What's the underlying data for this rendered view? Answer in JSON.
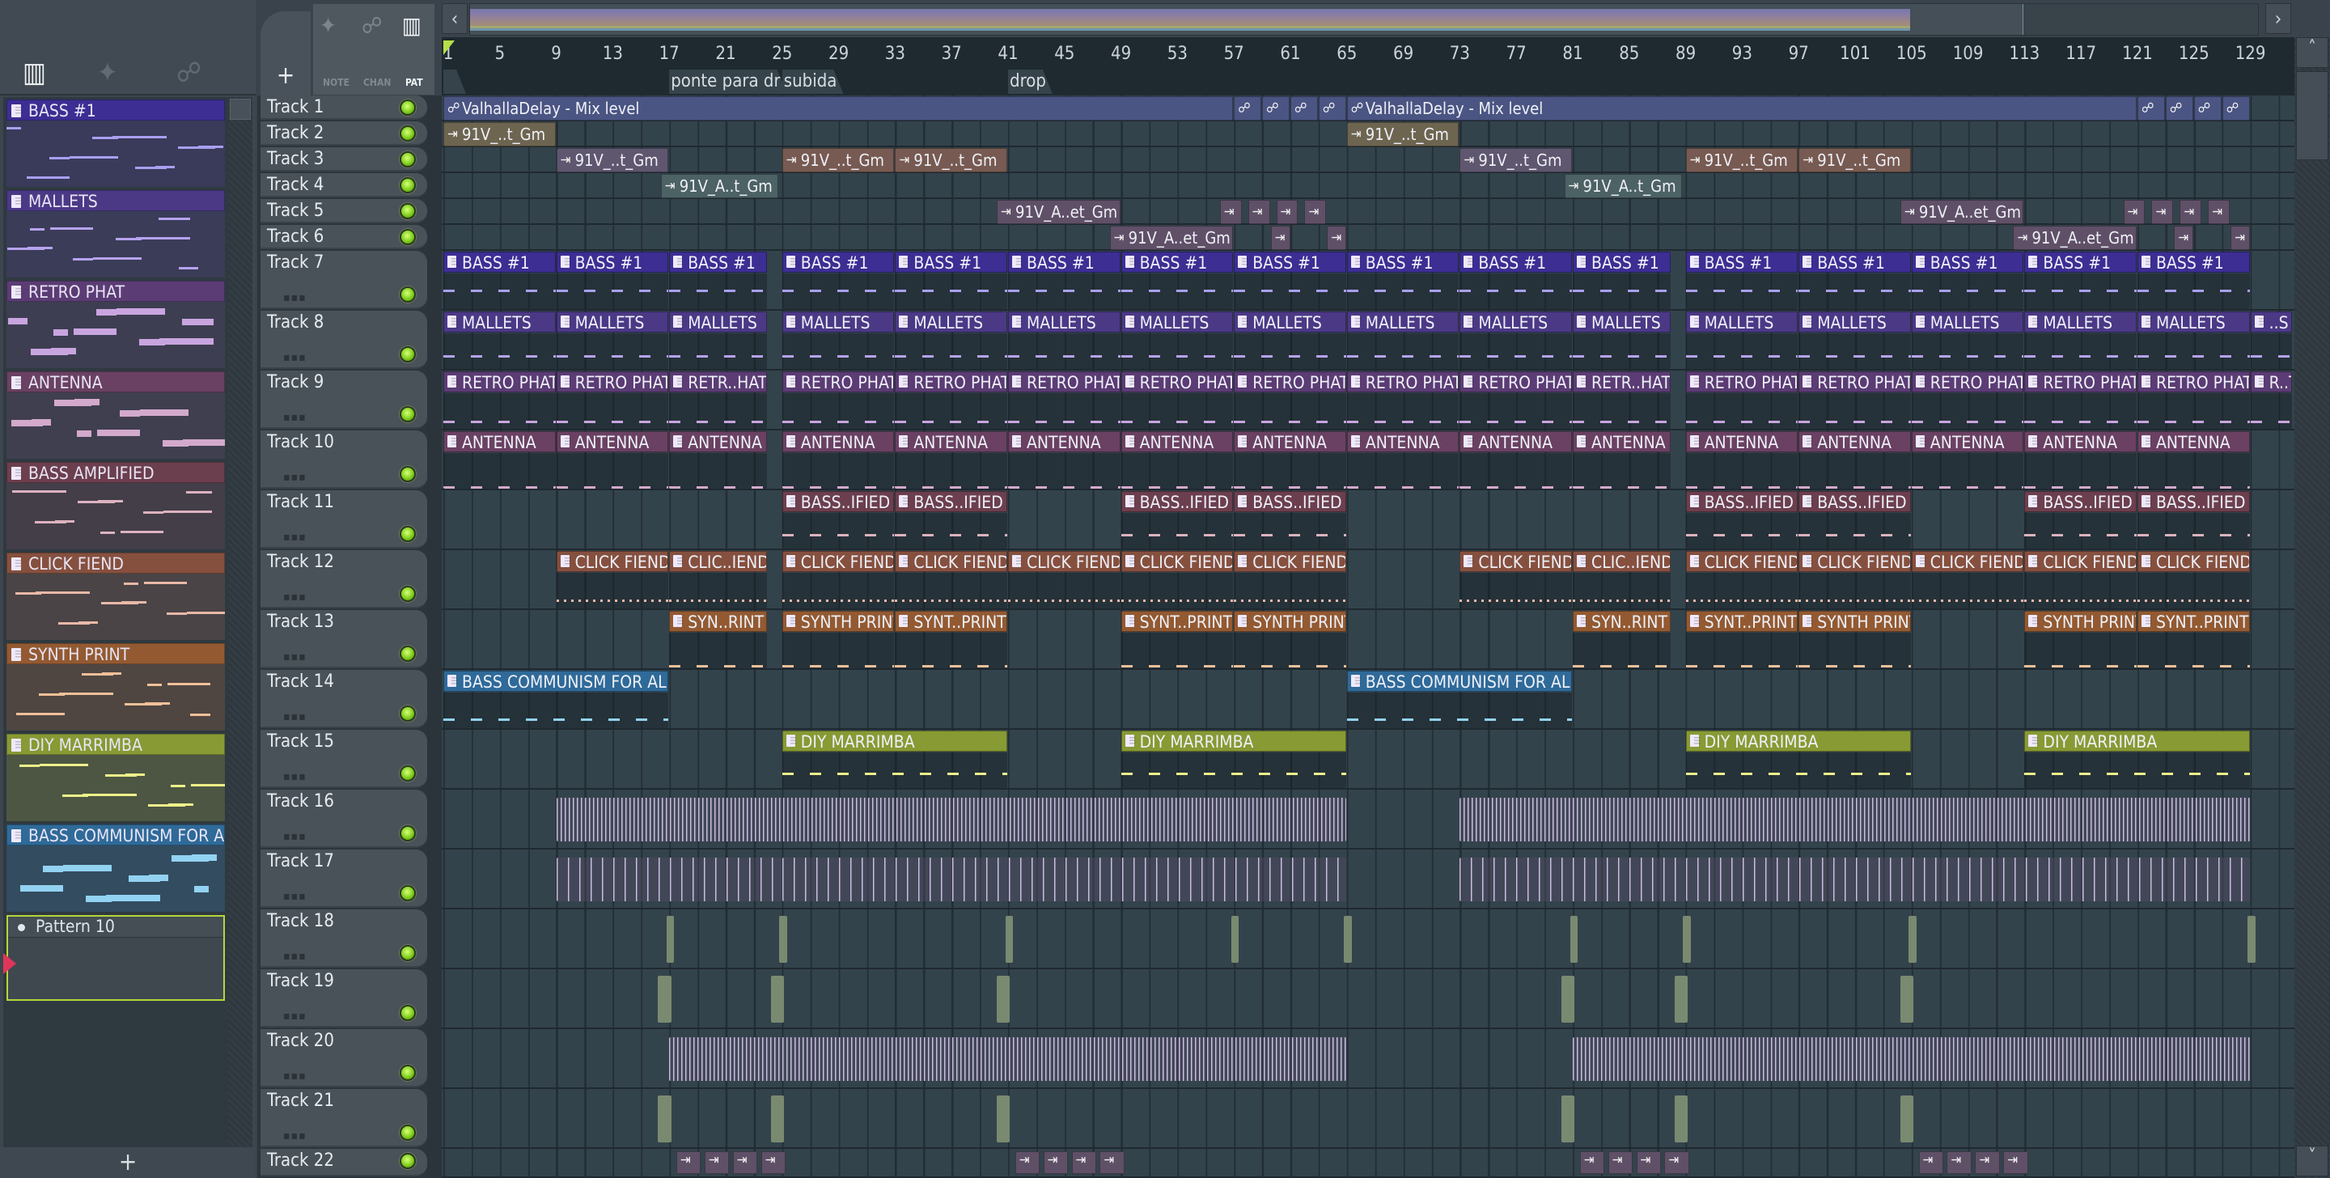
{
  "toolbar": {
    "note": "NOTE",
    "chan": "CHAN",
    "pat": "PAT",
    "add": "+",
    "add_pattern": "+",
    "nav_left": "‹",
    "nav_right": "›",
    "scroll_up": "˄",
    "scroll_down": "˅"
  },
  "ruler": {
    "bars": [
      "1",
      "5",
      "9",
      "13",
      "17",
      "21",
      "25",
      "29",
      "33",
      "37",
      "41",
      "45",
      "49",
      "53",
      "57",
      "61",
      "65",
      "69",
      "73",
      "77",
      "81",
      "85",
      "89",
      "93",
      "97",
      "101",
      "105",
      "109",
      "113",
      "117",
      "121",
      "125",
      "129"
    ]
  },
  "markers": [
    {
      "bar": 1,
      "label": ""
    },
    {
      "bar": 17,
      "label": "ponte para dr"
    },
    {
      "bar": 25,
      "label": "subida"
    },
    {
      "bar": 41,
      "label": "drop"
    }
  ],
  "patterns": [
    {
      "name": "BASS #1",
      "color": "#3c2e93",
      "body": "#3a3a5a",
      "note": "#a99ff0"
    },
    {
      "name": "MALLETS",
      "color": "#4b3986",
      "body": "#3b3c58",
      "note": "#b6a3ef"
    },
    {
      "name": "RETRO PHAT",
      "color": "#5b3c74",
      "body": "#3e3e52",
      "note": "#c9a5e0"
    },
    {
      "name": "ANTENNA",
      "color": "#6a4162",
      "body": "#403f4f",
      "note": "#d3a9cc"
    },
    {
      "name": "BASS AMPLIFIED",
      "color": "#6c3f4e",
      "body": "#433e48",
      "note": "#ddb2bf"
    },
    {
      "name": "CLICK FIEND",
      "color": "#86503f",
      "body": "#4a4446",
      "note": "#e9b8a8"
    },
    {
      "name": "SYNTH PRINT",
      "color": "#935a32",
      "body": "#4f4642",
      "note": "#f0c098"
    },
    {
      "name": "DIY MARRIMBA",
      "color": "#879a34",
      "body": "#4d5642",
      "note": "#eef08a"
    },
    {
      "name": "BASS COMMUNISM FOR ALL",
      "color": "#2f6a99",
      "body": "#334c60",
      "note": "#92d2f2"
    }
  ],
  "selected_pattern": "Pattern 10",
  "tracks": [
    "Track 1",
    "Track 2",
    "Track 3",
    "Track 4",
    "Track 5",
    "Track 6",
    "Track 7",
    "Track 8",
    "Track 9",
    "Track 10",
    "Track 11",
    "Track 12",
    "Track 13",
    "Track 14",
    "Track 15",
    "Track 16",
    "Track 17",
    "Track 18",
    "Track 19",
    "Track 20",
    "Track 21",
    "Track 22"
  ],
  "colors": {
    "auto": "#4b5583",
    "tan": "#6d6550",
    "mauve": "#5f566f",
    "brown": "#775a52",
    "teal": "#4c6264",
    "plum": "#5f5068",
    "wave": "#c9bde0"
  },
  "clips": [
    {
      "t": 1,
      "s": 1,
      "l": 56,
      "k": "auto",
      "c": "auto",
      "label": "ValhallaDelay - Mix level"
    },
    {
      "t": 1,
      "s": 57,
      "l": 2,
      "k": "auto",
      "c": "auto",
      "label": ""
    },
    {
      "t": 1,
      "s": 59,
      "l": 2,
      "k": "auto",
      "c": "auto",
      "label": ""
    },
    {
      "t": 1,
      "s": 61,
      "l": 2,
      "k": "auto",
      "c": "auto",
      "label": ""
    },
    {
      "t": 1,
      "s": 63,
      "l": 2,
      "k": "auto",
      "c": "auto",
      "label": ""
    },
    {
      "t": 1,
      "s": 65,
      "l": 56,
      "k": "auto",
      "c": "auto",
      "label": "ValhallaDelay - Mix level"
    },
    {
      "t": 1,
      "s": 121,
      "l": 2,
      "k": "auto",
      "c": "auto",
      "label": ""
    },
    {
      "t": 1,
      "s": 123,
      "l": 2,
      "k": "auto",
      "c": "auto",
      "label": ""
    },
    {
      "t": 1,
      "s": 125,
      "l": 2,
      "k": "auto",
      "c": "auto",
      "label": ""
    },
    {
      "t": 1,
      "s": 127,
      "l": 2,
      "k": "auto",
      "c": "auto",
      "label": ""
    },
    {
      "t": 2,
      "s": 1,
      "l": 8,
      "k": "audio",
      "c": "tan",
      "label": "91V_..t_Gm"
    },
    {
      "t": 2,
      "s": 65,
      "l": 8,
      "k": "audio",
      "c": "tan",
      "label": "91V_..t_Gm"
    },
    {
      "t": 3,
      "s": 9,
      "l": 8,
      "k": "audio",
      "c": "mauve",
      "label": "91V_..t_Gm"
    },
    {
      "t": 3,
      "s": 25,
      "l": 8,
      "k": "audio",
      "c": "brown",
      "label": "91V_..t_Gm"
    },
    {
      "t": 3,
      "s": 33,
      "l": 8,
      "k": "audio",
      "c": "brown",
      "label": "91V_..t_Gm"
    },
    {
      "t": 3,
      "s": 73,
      "l": 8,
      "k": "audio",
      "c": "mauve",
      "label": "91V_..t_Gm"
    },
    {
      "t": 3,
      "s": 89,
      "l": 8,
      "k": "audio",
      "c": "brown",
      "label": "91V_..t_Gm"
    },
    {
      "t": 3,
      "s": 97,
      "l": 8,
      "k": "audio",
      "c": "brown",
      "label": "91V_..t_Gm"
    },
    {
      "t": 4,
      "s": 16.4,
      "l": 8.4,
      "k": "audio",
      "c": "teal",
      "label": "91V_A..t_Gm"
    },
    {
      "t": 4,
      "s": 80.4,
      "l": 8.4,
      "k": "audio",
      "c": "teal",
      "label": "91V_A..t_Gm"
    },
    {
      "t": 5,
      "s": 40.2,
      "l": 8.8,
      "k": "audio",
      "c": "plum",
      "label": "91V_A..et_Gm"
    },
    {
      "t": 5,
      "s": 56,
      "l": 1.6,
      "k": "audio",
      "c": "plum",
      "label": ""
    },
    {
      "t": 5,
      "s": 58,
      "l": 1.6,
      "k": "audio",
      "c": "plum",
      "label": ""
    },
    {
      "t": 5,
      "s": 60,
      "l": 1.6,
      "k": "audio",
      "c": "plum",
      "label": ""
    },
    {
      "t": 5,
      "s": 62,
      "l": 1.6,
      "k": "audio",
      "c": "plum",
      "label": ""
    },
    {
      "t": 5,
      "s": 104.2,
      "l": 8.8,
      "k": "audio",
      "c": "plum",
      "label": "91V_A..et_Gm"
    },
    {
      "t": 5,
      "s": 120,
      "l": 1.6,
      "k": "audio",
      "c": "plum",
      "label": ""
    },
    {
      "t": 5,
      "s": 122,
      "l": 1.6,
      "k": "audio",
      "c": "plum",
      "label": ""
    },
    {
      "t": 5,
      "s": 124,
      "l": 1.6,
      "k": "audio",
      "c": "plum",
      "label": ""
    },
    {
      "t": 5,
      "s": 126,
      "l": 1.6,
      "k": "audio",
      "c": "plum",
      "label": ""
    },
    {
      "t": 6,
      "s": 48.2,
      "l": 8.8,
      "k": "audio",
      "c": "plum",
      "label": "91V_A..et_Gm"
    },
    {
      "t": 6,
      "s": 59.6,
      "l": 1.4,
      "k": "audio",
      "c": "plum",
      "label": ""
    },
    {
      "t": 6,
      "s": 63.6,
      "l": 1.4,
      "k": "audio",
      "c": "plum",
      "label": ""
    },
    {
      "t": 6,
      "s": 112.2,
      "l": 8.8,
      "k": "audio",
      "c": "plum",
      "label": "91V_A..et_Gm"
    },
    {
      "t": 6,
      "s": 123.6,
      "l": 1.4,
      "k": "audio",
      "c": "plum",
      "label": ""
    },
    {
      "t": 6,
      "s": 127.6,
      "l": 1.4,
      "k": "audio",
      "c": "plum",
      "label": ""
    }
  ],
  "pattern_clips": [
    {
      "t": 7,
      "p": 0,
      "clips": [
        [
          1,
          8,
          "BASS #1"
        ],
        [
          9,
          8,
          "BASS #1"
        ],
        [
          17,
          7,
          "BASS #1"
        ],
        [
          25,
          8,
          "BASS #1"
        ],
        [
          33,
          8,
          "BASS #1"
        ],
        [
          41,
          8,
          "BASS #1"
        ],
        [
          49,
          8,
          "BASS #1"
        ],
        [
          57,
          8,
          "BASS #1"
        ],
        [
          65,
          8,
          "BASS #1"
        ],
        [
          73,
          8,
          "BASS #1"
        ],
        [
          81,
          7,
          "BASS #1"
        ],
        [
          89,
          8,
          "BASS #1"
        ],
        [
          97,
          8,
          "BASS #1"
        ],
        [
          105,
          8,
          "BASS #1"
        ],
        [
          113,
          8,
          "BASS #1"
        ],
        [
          121,
          8,
          "BASS #1"
        ]
      ]
    },
    {
      "t": 8,
      "p": 1,
      "clips": [
        [
          1,
          8,
          "MALLETS"
        ],
        [
          9,
          8,
          "MALLETS"
        ],
        [
          17,
          7,
          "MALLETS"
        ],
        [
          25,
          8,
          "MALLETS"
        ],
        [
          33,
          8,
          "MALLETS"
        ],
        [
          41,
          8,
          "MALLETS"
        ],
        [
          49,
          8,
          "MALLETS"
        ],
        [
          57,
          8,
          "MALLETS"
        ],
        [
          65,
          8,
          "MALLETS"
        ],
        [
          73,
          8,
          "MALLETS"
        ],
        [
          81,
          7,
          "MALLETS"
        ],
        [
          89,
          8,
          "MALLETS"
        ],
        [
          97,
          8,
          "MALLETS"
        ],
        [
          105,
          8,
          "MALLETS"
        ],
        [
          113,
          8,
          "MALLETS"
        ],
        [
          121,
          8,
          "MALLETS"
        ],
        [
          129,
          3,
          "..S"
        ]
      ]
    },
    {
      "t": 9,
      "p": 2,
      "clips": [
        [
          1,
          8,
          "RETRO PHAT"
        ],
        [
          9,
          8,
          "RETRO PHAT"
        ],
        [
          17,
          7,
          "RETR..HAT"
        ],
        [
          25,
          8,
          "RETRO PHAT"
        ],
        [
          33,
          8,
          "RETRO PHAT"
        ],
        [
          41,
          8,
          "RETRO PHAT"
        ],
        [
          49,
          8,
          "RETRO PHAT"
        ],
        [
          57,
          8,
          "RETRO PHAT"
        ],
        [
          65,
          8,
          "RETRO PHAT"
        ],
        [
          73,
          8,
          "RETRO PHAT"
        ],
        [
          81,
          7,
          "RETR..HAT"
        ],
        [
          89,
          8,
          "RETRO PHAT"
        ],
        [
          97,
          8,
          "RETRO PHAT"
        ],
        [
          105,
          8,
          "RETRO PHAT"
        ],
        [
          113,
          8,
          "RETRO PHAT"
        ],
        [
          121,
          8,
          "RETRO PHAT"
        ],
        [
          129,
          3,
          "R..T"
        ]
      ]
    },
    {
      "t": 10,
      "p": 3,
      "clips": [
        [
          1,
          8,
          "ANTENNA"
        ],
        [
          9,
          8,
          "ANTENNA"
        ],
        [
          17,
          7,
          "ANTENNA"
        ],
        [
          25,
          8,
          "ANTENNA"
        ],
        [
          33,
          8,
          "ANTENNA"
        ],
        [
          41,
          8,
          "ANTENNA"
        ],
        [
          49,
          8,
          "ANTENNA"
        ],
        [
          57,
          8,
          "ANTENNA"
        ],
        [
          65,
          8,
          "ANTENNA"
        ],
        [
          73,
          8,
          "ANTENNA"
        ],
        [
          81,
          7,
          "ANTENNA"
        ],
        [
          89,
          8,
          "ANTENNA"
        ],
        [
          97,
          8,
          "ANTENNA"
        ],
        [
          105,
          8,
          "ANTENNA"
        ],
        [
          113,
          8,
          "ANTENNA"
        ],
        [
          121,
          8,
          "ANTENNA"
        ]
      ]
    },
    {
      "t": 11,
      "p": 4,
      "clips": [
        [
          25,
          8,
          "BASS..IFIED"
        ],
        [
          33,
          8,
          "BASS..IFIED"
        ],
        [
          49,
          8,
          "BASS..IFIED"
        ],
        [
          57,
          8,
          "BASS..IFIED"
        ],
        [
          89,
          8,
          "BASS..IFIED"
        ],
        [
          97,
          8,
          "BASS..IFIED"
        ],
        [
          113,
          8,
          "BASS..IFIED"
        ],
        [
          121,
          8,
          "BASS..IFIED"
        ]
      ]
    },
    {
      "t": 12,
      "p": 5,
      "clips": [
        [
          9,
          8,
          "CLICK FIEND"
        ],
        [
          17,
          7,
          "CLIC..IEND"
        ],
        [
          25,
          8,
          "CLICK FIEND"
        ],
        [
          33,
          8,
          "CLICK FIEND"
        ],
        [
          41,
          8,
          "CLICK FIEND"
        ],
        [
          49,
          8,
          "CLICK FIEND"
        ],
        [
          57,
          8,
          "CLICK FIEND"
        ],
        [
          73,
          8,
          "CLICK FIEND"
        ],
        [
          81,
          7,
          "CLIC..IEND"
        ],
        [
          89,
          8,
          "CLICK FIEND"
        ],
        [
          97,
          8,
          "CLICK FIEND"
        ],
        [
          105,
          8,
          "CLICK FIEND"
        ],
        [
          113,
          8,
          "CLICK FIEND"
        ],
        [
          121,
          8,
          "CLICK FIEND"
        ]
      ]
    },
    {
      "t": 13,
      "p": 6,
      "clips": [
        [
          17,
          7,
          "SYN..RINT"
        ],
        [
          25,
          8,
          "SYNTH PRINT"
        ],
        [
          33,
          8,
          "SYNT..PRINT"
        ],
        [
          49,
          8,
          "SYNT..PRINT"
        ],
        [
          57,
          8,
          "SYNTH PRINT"
        ],
        [
          81,
          7,
          "SYN..RINT"
        ],
        [
          89,
          8,
          "SYNT..PRINT"
        ],
        [
          97,
          8,
          "SYNTH PRINT"
        ],
        [
          113,
          8,
          "SYNTH PRINT"
        ],
        [
          121,
          8,
          "SYNT..PRINT"
        ]
      ]
    },
    {
      "t": 14,
      "p": 8,
      "clips": [
        [
          1,
          16,
          "BASS COMMUNISM FOR ALL"
        ],
        [
          65,
          16,
          "BASS COMMUNISM FOR ALL"
        ]
      ]
    },
    {
      "t": 15,
      "p": 7,
      "clips": [
        [
          25,
          16,
          "DIY MARRIMBA"
        ],
        [
          49,
          16,
          "DIY MARRIMBA"
        ],
        [
          89,
          16,
          "DIY MARRIMBA"
        ],
        [
          113,
          16,
          "DIY MARRIMBA"
        ]
      ]
    }
  ],
  "wave_clips": [
    {
      "t": 16,
      "ranges": [
        [
          9,
          56
        ],
        [
          73,
          56
        ]
      ],
      "style": "dense"
    },
    {
      "t": 17,
      "ranges": [
        [
          9,
          16
        ],
        [
          25,
          40
        ],
        [
          73,
          16
        ],
        [
          89,
          40
        ]
      ],
      "style": "sparse"
    },
    {
      "t": 18,
      "ranges": [
        [
          16.8,
          0.6
        ],
        [
          24.8,
          0.6
        ],
        [
          40.8,
          0.6
        ],
        [
          56.8,
          0.6
        ],
        [
          64.8,
          0.6
        ],
        [
          80.8,
          0.6
        ],
        [
          88.8,
          0.6
        ],
        [
          104.8,
          0.6
        ],
        [
          128.8,
          0.6
        ]
      ],
      "style": "hit"
    },
    {
      "t": 19,
      "ranges": [
        [
          16.2,
          1
        ],
        [
          24.2,
          1
        ],
        [
          40.2,
          1
        ],
        [
          80.2,
          1
        ],
        [
          88.2,
          1
        ],
        [
          104.2,
          1
        ]
      ],
      "style": "hit"
    },
    {
      "t": 20,
      "ranges": [
        [
          17,
          48
        ],
        [
          81,
          48
        ]
      ],
      "style": "dense"
    },
    {
      "t": 21,
      "ranges": [
        [
          16.2,
          1
        ],
        [
          24.2,
          1
        ],
        [
          40.2,
          1
        ],
        [
          80.2,
          1
        ],
        [
          88.2,
          1
        ],
        [
          104.2,
          1
        ]
      ],
      "style": "hit"
    },
    {
      "t": 22,
      "ranges": [
        [
          17.5,
          1.8
        ],
        [
          19.5,
          1.8
        ],
        [
          21.5,
          1.8
        ],
        [
          23.5,
          1.8
        ],
        [
          41.5,
          1.8
        ],
        [
          43.5,
          1.8
        ],
        [
          45.5,
          1.8
        ],
        [
          47.5,
          1.8
        ],
        [
          81.5,
          1.8
        ],
        [
          83.5,
          1.8
        ],
        [
          85.5,
          1.8
        ],
        [
          87.5,
          1.8
        ],
        [
          105.5,
          1.8
        ],
        [
          107.5,
          1.8
        ],
        [
          109.5,
          1.8
        ],
        [
          111.5,
          1.8
        ]
      ],
      "style": "mini"
    }
  ]
}
